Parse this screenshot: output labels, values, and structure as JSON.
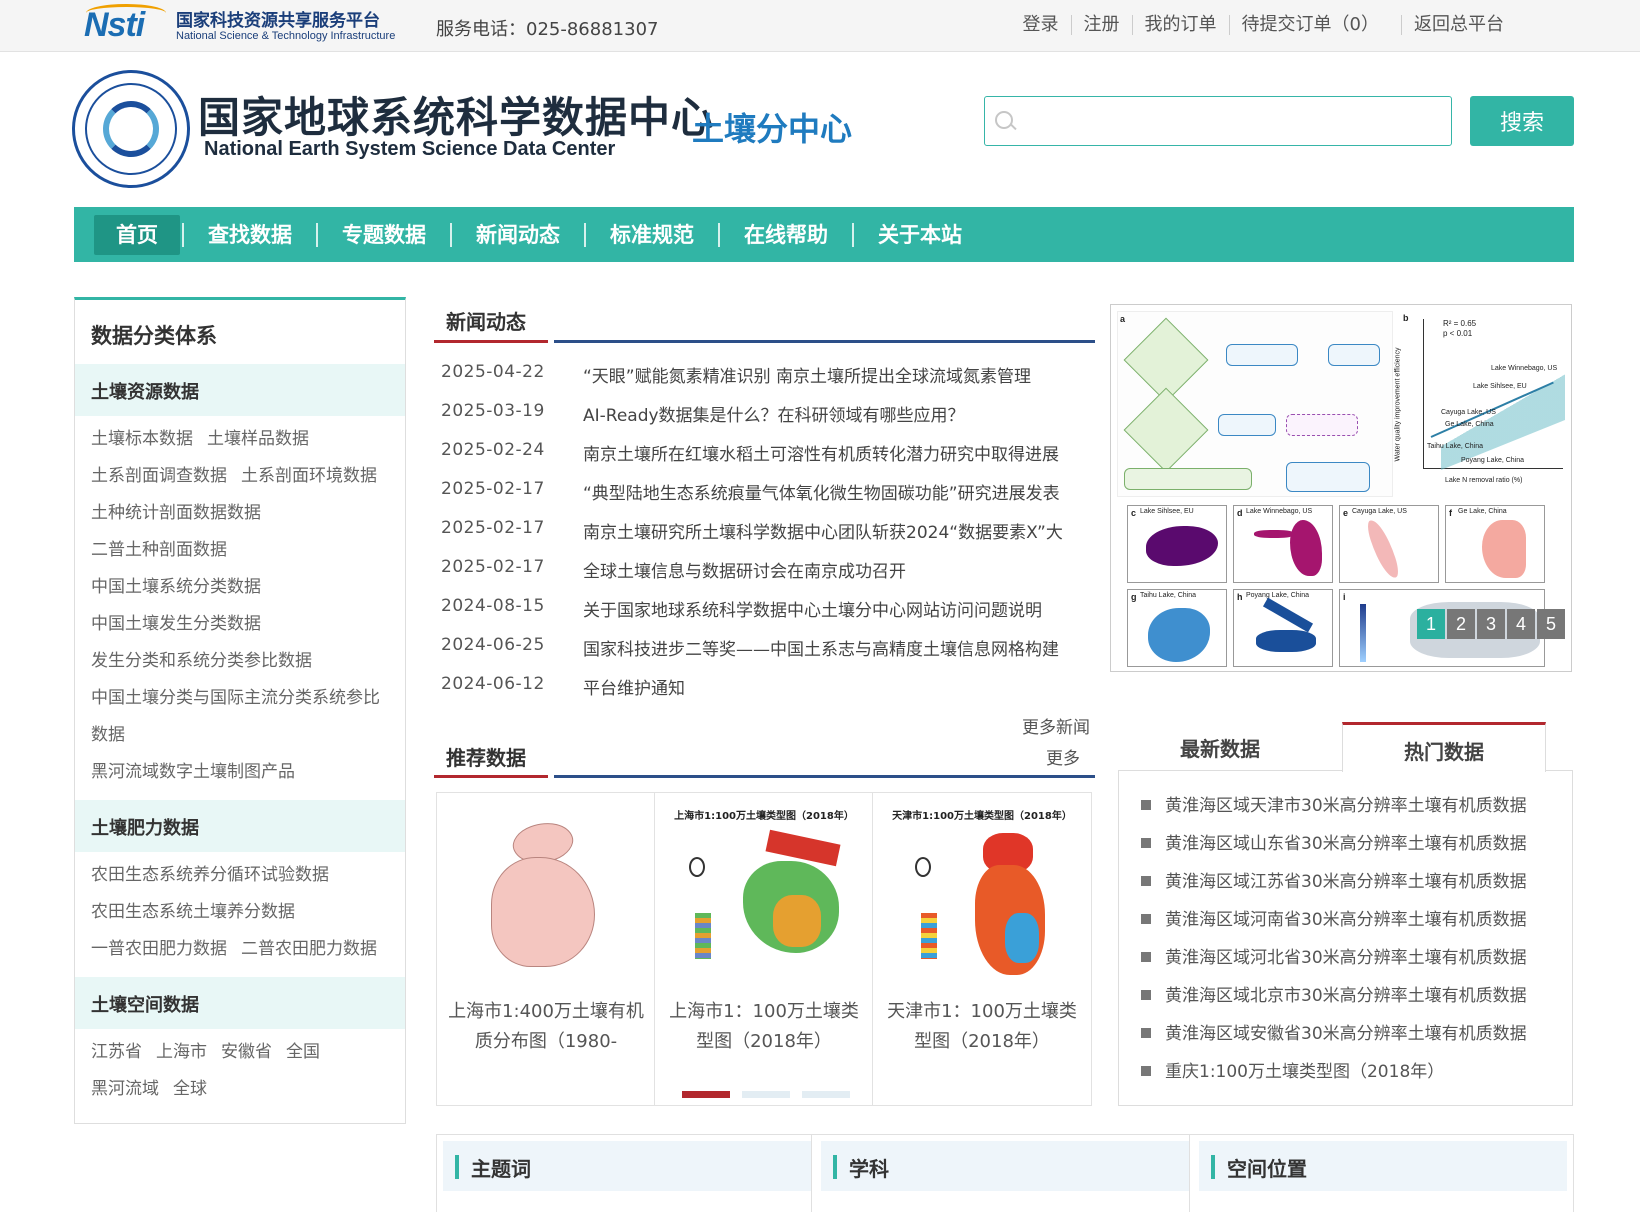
{
  "topbar": {
    "nsti_mark": "Nsti",
    "nsti_cn": "国家科技资源共享服务平台",
    "nsti_en": "National Science & Technology Infrastructure",
    "hotline": "服务电话：025-86881307",
    "links": [
      "登录",
      "注册",
      "我的订单",
      "待提交订单（0）",
      "返回总平台"
    ]
  },
  "header": {
    "title_cn": "国家地球系统科学数据中心",
    "title_en": "National Earth System Science Data Center",
    "sub_center": "土壤分中心",
    "search_placeholder": "",
    "search_button": "搜索"
  },
  "nav": [
    "首页",
    "查找数据",
    "专题数据",
    "新闻动态",
    "标准规范",
    "在线帮助",
    "关于本站"
  ],
  "sidebar": {
    "title": "数据分类体系",
    "groups": [
      {
        "head": "土壤资源数据",
        "lines": [
          [
            "土壤标本数据",
            "土壤样品数据"
          ],
          [
            "土系剖面调查数据",
            "土系剖面环境数据"
          ],
          [
            "土种统计剖面数据数据"
          ],
          [
            "二普土种剖面数据"
          ],
          [
            "中国土壤系统分类数据"
          ],
          [
            "中国土壤发生分类数据"
          ],
          [
            "发生分类和系统分类参比数据"
          ],
          [
            "中国土壤分类与国际主流分类系统参比"
          ],
          [
            "数据"
          ],
          [
            "黑河流域数字土壤制图产品"
          ]
        ]
      },
      {
        "head": "土壤肥力数据",
        "lines": [
          [
            "农田生态系统养分循环试验数据"
          ],
          [
            "农田生态系统土壤养分数据"
          ],
          [
            "一普农田肥力数据",
            "二普农田肥力数据"
          ]
        ]
      },
      {
        "head": "土壤空间数据",
        "lines": [
          [
            "江苏省",
            "上海市",
            "安徽省",
            "全国"
          ],
          [
            "黑河流域",
            "全球"
          ]
        ]
      }
    ]
  },
  "news": {
    "title": "新闻动态",
    "more": "更多新闻",
    "items": [
      {
        "date": "2025-04-22",
        "text": "“天眼”赋能氮素精准识别 南京土壤所提出全球流域氮素管理"
      },
      {
        "date": "2025-03-19",
        "text": "AI-Ready数据集是什么？在科研领域有哪些应用？"
      },
      {
        "date": "2025-02-24",
        "text": "南京土壤所在红壤水稻土可溶性有机质转化潜力研究中取得进展"
      },
      {
        "date": "2025-02-17",
        "text": "“典型陆地生态系统痕量气体氧化微生物固碳功能”研究进展发表"
      },
      {
        "date": "2025-02-17",
        "text": "南京土壤研究所土壤科学数据中心团队斩获2024“数据要素X”大"
      },
      {
        "date": "2025-02-17",
        "text": "全球土壤信息与数据研讨会在南京成功召开"
      },
      {
        "date": "2024-08-15",
        "text": "关于国家地球系统科学数据中心土壤分中心网站访问问题说明"
      },
      {
        "date": "2024-06-25",
        "text": "国家科技进步二等奖——中国土系志与高精度土壤信息网格构建"
      },
      {
        "date": "2024-06-12",
        "text": "平台维护通知"
      }
    ]
  },
  "figure": {
    "panel_a": "a",
    "panel_b": "b",
    "stats": "R² = 0.65",
    "p_value": "p < 0.01",
    "y_axis": "Water quality improvement efficiency",
    "x_axis": "Lake N removal ratio (%)",
    "lakes": [
      "Lake Winnebago, US",
      "Lake Sihlsee, EU",
      "Cayuga Lake, US",
      "Ge Lake, China",
      "Taihu Lake, China",
      "Poyang Lake, China"
    ],
    "panels": [
      {
        "label": "c",
        "name": "Lake Sihlsee, EU",
        "color": "#5a0a6e"
      },
      {
        "label": "d",
        "name": "Lake Winnebago, US",
        "color": "#a5156e"
      },
      {
        "label": "e",
        "name": "Cayuga Lake, US",
        "color": "#f3b8b8"
      },
      {
        "label": "f",
        "name": "Ge Lake, China",
        "color": "#f4a9a0"
      },
      {
        "label": "g",
        "name": "Taihu Lake, China",
        "color": "#3f8fcf"
      },
      {
        "label": "h",
        "name": "Poyang Lake, China",
        "color": "#1a4f9a"
      },
      {
        "label": "i",
        "name": "",
        "color": "#cfd6dd"
      }
    ],
    "pager": [
      "1",
      "2",
      "3",
      "4",
      "5"
    ],
    "active_page": "1"
  },
  "recommend": {
    "title": "推荐数据",
    "more": "更多",
    "cards": [
      {
        "map_title": "",
        "caption": "上海市1:400万土壤有机质分布图（1980-",
        "color": "#f4c6c0"
      },
      {
        "map_title": "上海市1:100万土壤类型图（2018年）",
        "caption": "上海市1：100万土壤类型图（2018年）",
        "color": "#5fb85a"
      },
      {
        "map_title": "天津市1:100万土壤类型图（2018年）",
        "caption": "天津市1：100万土壤类型图（2018年）",
        "color": "#e85a28"
      }
    ]
  },
  "tabs": {
    "items": [
      "最新数据",
      "热门数据"
    ],
    "active": "热门数据",
    "hot": [
      "黄淮海区域天津市30米高分辨率土壤有机质数据",
      "黄淮海区域山东省30米高分辨率土壤有机质数据",
      "黄淮海区域江苏省30米高分辨率土壤有机质数据",
      "黄淮海区域河南省30米高分辨率土壤有机质数据",
      "黄淮海区域河北省30米高分辨率土壤有机质数据",
      "黄淮海区域北京市30米高分辨率土壤有机质数据",
      "黄淮海区域安徽省30米高分辨率土壤有机质数据",
      "重庆1:100万土壤类型图（2018年）"
    ]
  },
  "bottom": [
    "主题词",
    "学科",
    "空间位置"
  ],
  "colors": {
    "teal": "#32b5a5",
    "red": "#b2282e",
    "navy": "#2c4f89",
    "blue": "#1f7bbf"
  }
}
